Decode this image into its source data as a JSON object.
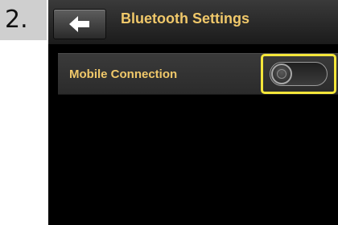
{
  "step": {
    "number": "2."
  },
  "header": {
    "title": "Bluetooth Settings",
    "back_icon": "arrow-left-icon"
  },
  "settings": [
    {
      "label": "Mobile Connection",
      "toggle": {
        "state": "off",
        "highlighted": true
      }
    }
  ],
  "colors": {
    "title_text": "#f0c86a",
    "highlight": "#f4e63a",
    "screen_background": "#000000",
    "step_tab_background": "#cfcfcf"
  }
}
